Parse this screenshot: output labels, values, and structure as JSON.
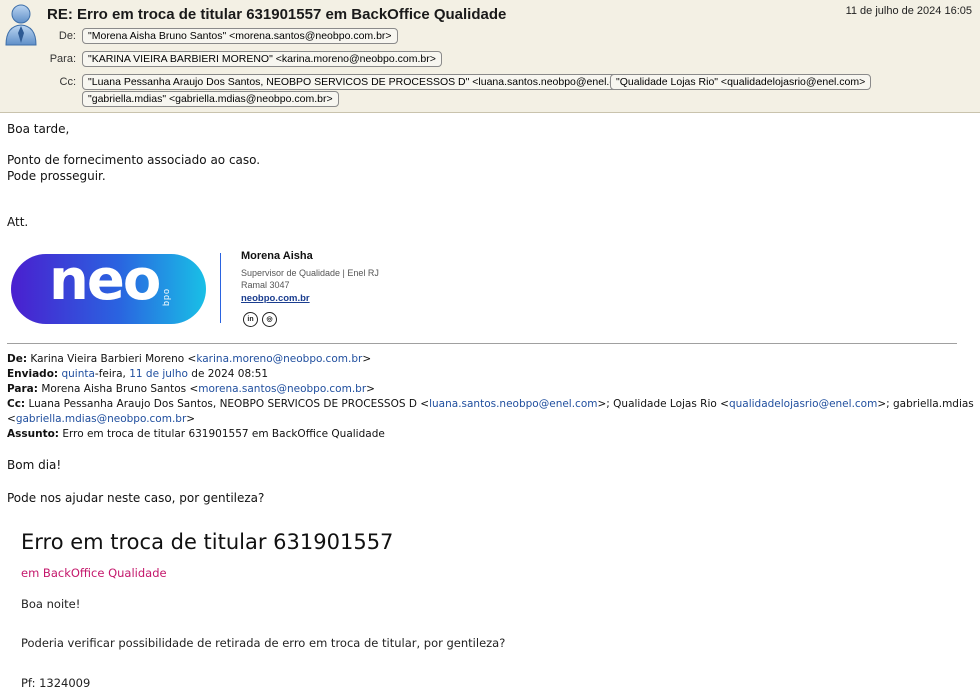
{
  "header": {
    "subject": "RE: Erro em troca de titular 631901557 em BackOffice Qualidade",
    "date": "11 de julho de 2024 16:05",
    "from_label": "De:",
    "to_label": "Para:",
    "cc_label": "Cc:",
    "from": "\"Morena Aisha Bruno Santos\" <morena.santos@neobpo.com.br>",
    "to": "\"KARINA VIEIRA BARBIERI MORENO\" <karina.moreno@neobpo.com.br>",
    "cc": [
      "\"Luana Pessanha Araujo Dos Santos, NEOBPO SERVICOS DE PROCESSOS D\" <luana.santos.neobpo@enel.com>",
      "\"Qualidade Lojas Rio\" <qualidadelojasrio@enel.com>",
      "\"gabriella.mdias\" <gabriella.mdias@neobpo.com.br>"
    ]
  },
  "body": {
    "greeting": "Boa tarde,",
    "line1": "Ponto de fornecimento associado ao caso.",
    "line2": "Pode prosseguir.",
    "closing": "Att."
  },
  "signature": {
    "logo_text": "neo",
    "logo_sub": "bpo",
    "name": "Morena Aisha",
    "role": "Supervisor de Qualidade  |  Enel RJ",
    "ramal": "Ramal 3047",
    "link": "neobpo.com.br",
    "colors": {
      "logo_start": "#4a1fcf",
      "logo_end": "#19c0e6"
    }
  },
  "quoted": {
    "de_label": "De:",
    "de_name": "Karina Vieira Barbieri Moreno <",
    "de_email": "karina.moreno@neobpo.com.br",
    "de_end": ">",
    "enviado_label": "Enviado:",
    "enviado_day": "quinta",
    "enviado_mid": "-feira, ",
    "enviado_date": "11 de julho",
    "enviado_end": " de 2024 08:51",
    "para_label": "Para:",
    "para_name": "Morena Aisha Bruno Santos <",
    "para_email": "morena.santos@neobpo.com.br",
    "para_end": ">",
    "cc_label": "Cc:",
    "cc_1": "Luana Pessanha Araujo Dos Santos, NEOBPO SERVICOS DE PROCESSOS D <",
    "cc_1_email": "luana.santos.neobpo@enel.com",
    "cc_2": ">; Qualidade Lojas Rio <",
    "cc_2_email": "qualidadelojasrio@enel.com",
    "cc_3": ">; gabriella.mdias",
    "cc_4": "<",
    "cc_4_email": "gabriella.mdias@neobpo.com.br",
    "cc_5": ">",
    "assunto_label": "Assunto:",
    "assunto": "Erro em troca de titular 631901557 em BackOffice Qualidade",
    "greeting": "Bom dia!",
    "request": "Pode nos ajudar neste caso, por gentileza?"
  },
  "card": {
    "title": "Erro em troca de titular 631901557",
    "subtitle": "em BackOffice Qualidade",
    "greeting": "Boa noite!",
    "question": "Poderia verificar possibilidade de retirada de erro em troca de titular, por gentileza?",
    "pf": "Pf: 1324009",
    "subtitle_color": "#c4176b"
  }
}
